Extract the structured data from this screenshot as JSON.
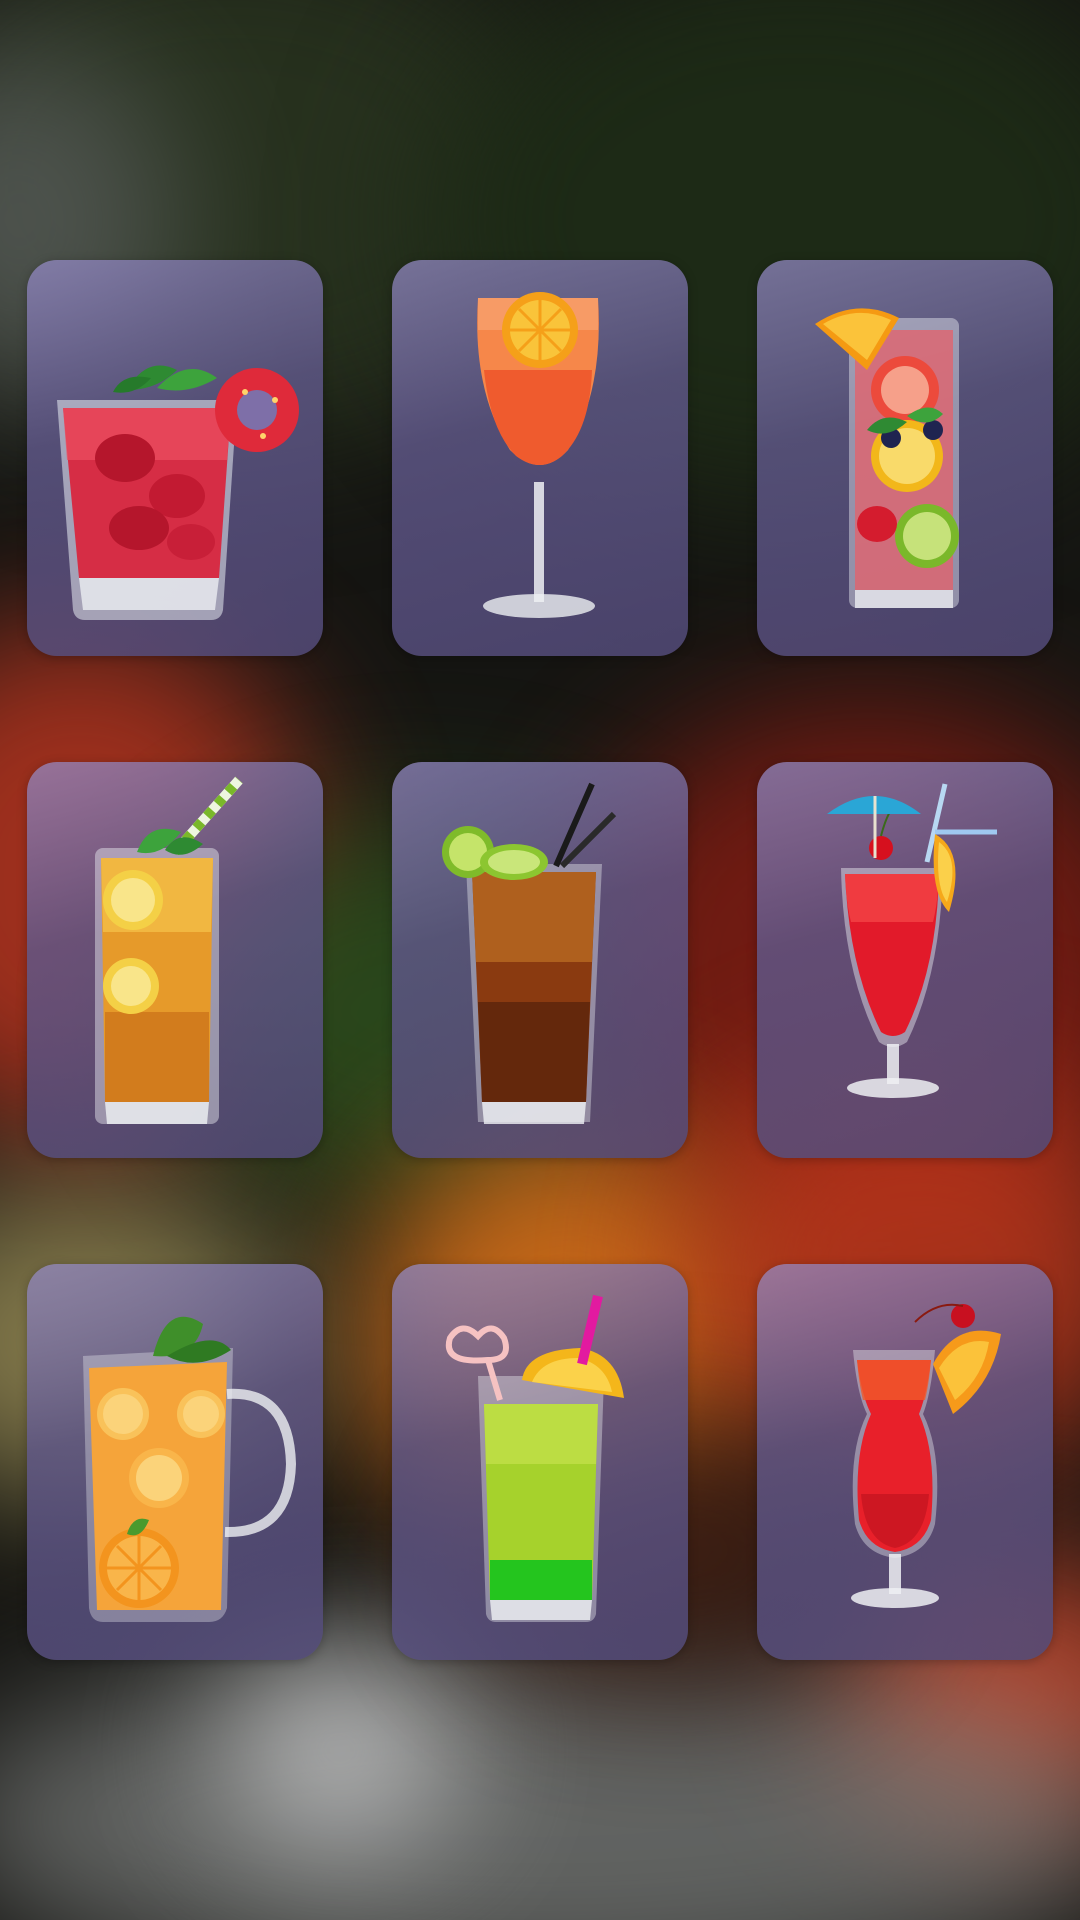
{
  "background": {
    "style": "blurred cocktail bar photo",
    "accent_colors": [
      "#27311e",
      "#b5341f",
      "#e2751a",
      "#7a1b12",
      "#8a8d8c"
    ]
  },
  "tile_style": {
    "fill": "#6a6298",
    "opacity": 0.82
  },
  "drinks": [
    {
      "icon": "strawberry-mojito-icon",
      "colors": [
        "#e0324a",
        "#ffffff",
        "#2f8a33"
      ]
    },
    {
      "icon": "aperol-spritz-icon",
      "colors": [
        "#f4733a",
        "#f39c1a",
        "#e9e9ee"
      ]
    },
    {
      "icon": "fruit-infused-water-icon",
      "colors": [
        "#e9433a",
        "#f7a21a",
        "#7fbe2a"
      ]
    },
    {
      "icon": "lemon-iced-tea-icon",
      "colors": [
        "#e28e24",
        "#f4d55a",
        "#5aa93a"
      ]
    },
    {
      "icon": "long-island-iced-tea-icon",
      "colors": [
        "#6a2e0f",
        "#a5c838",
        "#1a1a1a"
      ]
    },
    {
      "icon": "red-tropical-cocktail-icon",
      "colors": [
        "#e21a2a",
        "#f6a81a",
        "#2aa6d6"
      ]
    },
    {
      "icon": "orange-juice-pitcher-icon",
      "colors": [
        "#f5a43a",
        "#f9c25a",
        "#3f8f2a"
      ]
    },
    {
      "icon": "green-layered-cocktail-icon",
      "colors": [
        "#a5d62a",
        "#2bd12a",
        "#f4b61a"
      ]
    },
    {
      "icon": "hurricane-cocktail-icon",
      "colors": [
        "#e8202a",
        "#f69a1a",
        "#c21420"
      ]
    }
  ]
}
